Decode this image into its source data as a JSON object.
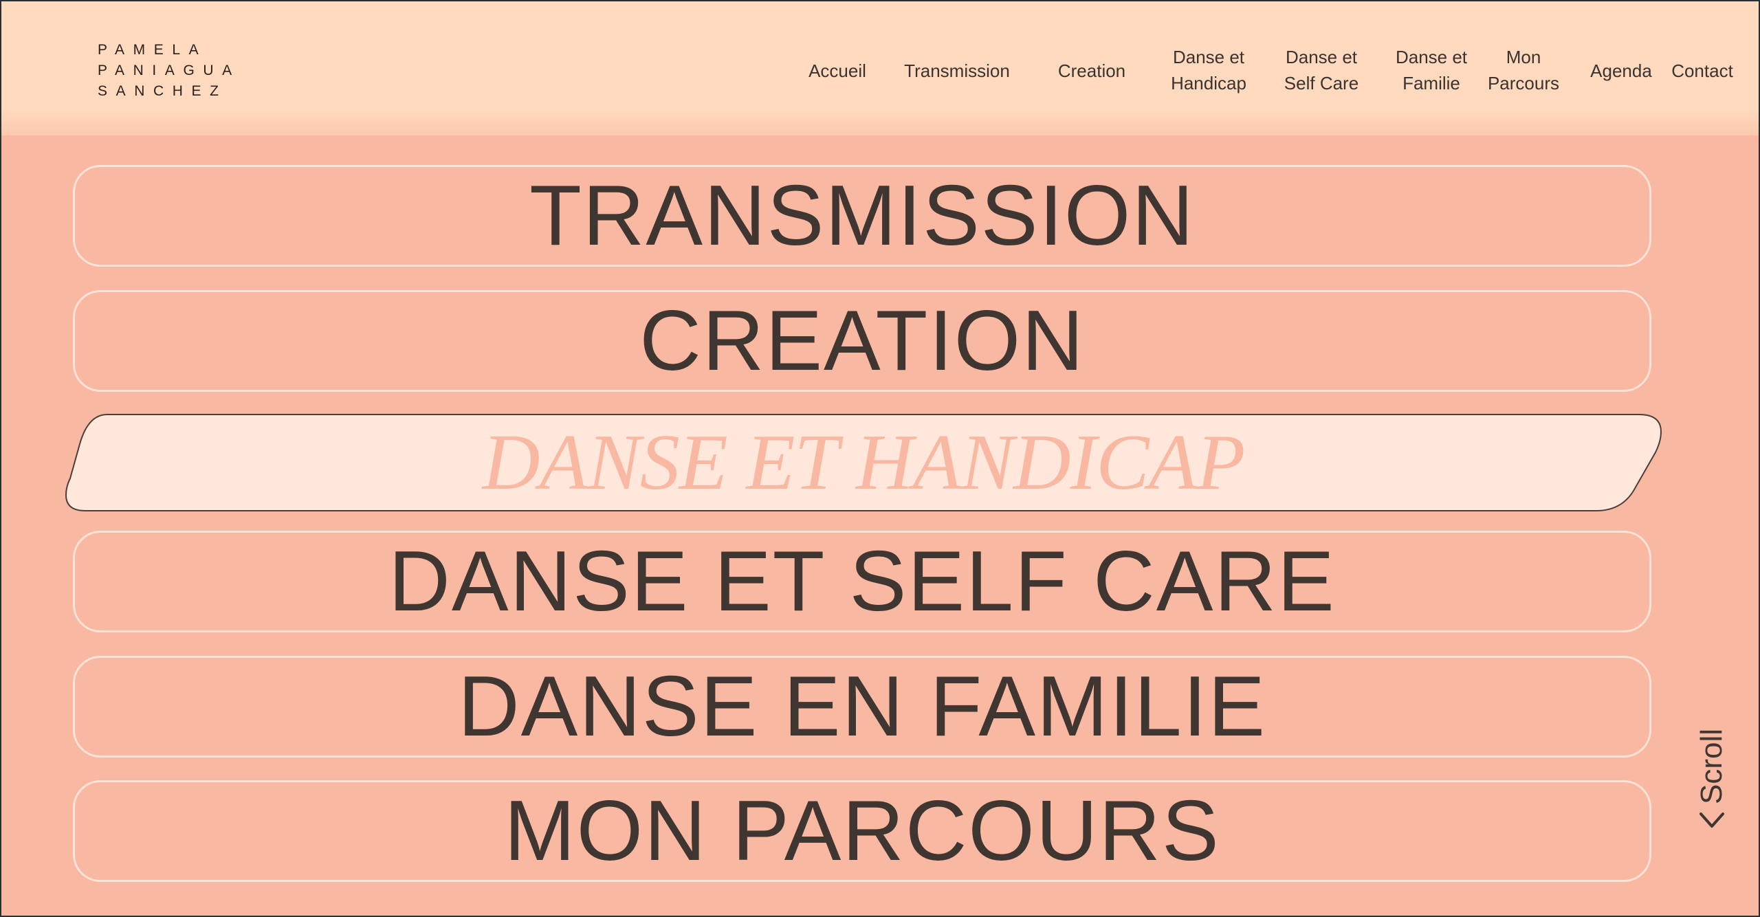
{
  "logo": {
    "line1": "PAMELA",
    "line2": "PANIAGUA",
    "line3": "SANCHEZ"
  },
  "nav": {
    "items": [
      {
        "line1": "Accueil",
        "line2": ""
      },
      {
        "line1": "Transmission",
        "line2": ""
      },
      {
        "line1": "Creation",
        "line2": ""
      },
      {
        "line1": "Danse et",
        "line2": "Handicap"
      },
      {
        "line1": "Danse et",
        "line2": "Self Care"
      },
      {
        "line1": "Danse et",
        "line2": "Familie"
      },
      {
        "line1": "Mon",
        "line2": "Parcours"
      },
      {
        "line1": "Agenda",
        "line2": ""
      },
      {
        "line1": "Contact",
        "line2": ""
      }
    ]
  },
  "menu": {
    "items": [
      {
        "label": "TRANSMISSION"
      },
      {
        "label": "CREATION"
      },
      {
        "label": "DANSE ET HANDICAP",
        "active": true
      },
      {
        "label": "DANSE ET SELF CARE"
      },
      {
        "label": "DANSE EN FAMILIE"
      },
      {
        "label": "MON PARCOURS"
      }
    ]
  },
  "scroll": {
    "label": "Scroll",
    "icon": "chevron-down-icon"
  },
  "colors": {
    "background": "#f9b8a1",
    "header": "#ffdabe",
    "text": "#3f3632",
    "active_fill": "#ffe7dc",
    "active_text": "#f9b8a1",
    "border": "#fde3d7"
  }
}
